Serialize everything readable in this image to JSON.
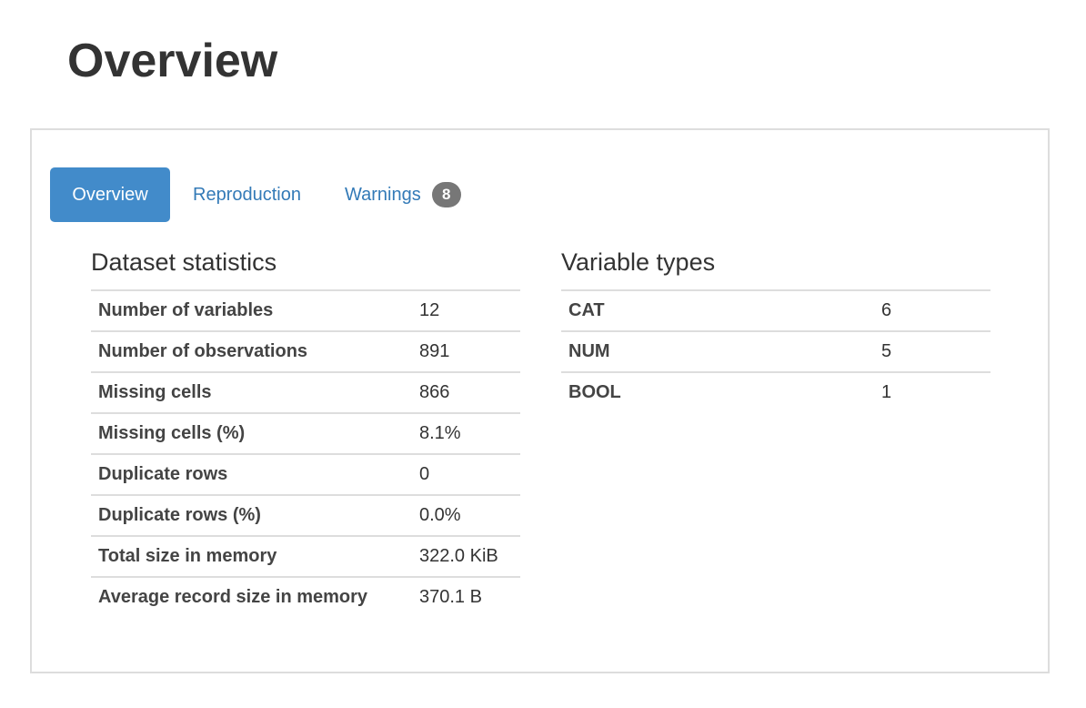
{
  "page": {
    "title": "Overview"
  },
  "tabs": [
    {
      "label": "Overview",
      "active": true
    },
    {
      "label": "Reproduction",
      "active": false
    },
    {
      "label": "Warnings",
      "active": false,
      "badge": "8"
    }
  ],
  "dataset_statistics": {
    "title": "Dataset statistics",
    "rows": [
      {
        "label": "Number of variables",
        "value": "12"
      },
      {
        "label": "Number of observations",
        "value": "891"
      },
      {
        "label": "Missing cells",
        "value": "866"
      },
      {
        "label": "Missing cells (%)",
        "value": "8.1%"
      },
      {
        "label": "Duplicate rows",
        "value": "0"
      },
      {
        "label": "Duplicate rows (%)",
        "value": "0.0%"
      },
      {
        "label": "Total size in memory",
        "value": "322.0 KiB"
      },
      {
        "label": "Average record size in memory",
        "value": "370.1 B"
      }
    ]
  },
  "variable_types": {
    "title": "Variable types",
    "rows": [
      {
        "label": "CAT",
        "value": "6"
      },
      {
        "label": "NUM",
        "value": "5"
      },
      {
        "label": "BOOL",
        "value": "1"
      }
    ]
  },
  "colors": {
    "accent": "#428bca",
    "link": "#337ab7",
    "badge": "#777777",
    "border": "#dddddd",
    "text": "#333333"
  }
}
